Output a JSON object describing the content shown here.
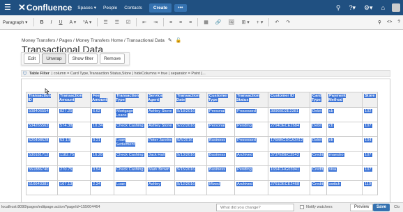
{
  "topnav": {
    "logo": "Confluence",
    "menu": [
      "Spaces ▾",
      "People",
      "Contacts"
    ],
    "create_label": "Create",
    "more_label": "•••",
    "icons": [
      "search-icon",
      "help-icon",
      "settings-icon",
      "notifications-icon",
      "avatar"
    ]
  },
  "toolbar": {
    "paragraph_label": "Paragraph ▾",
    "buttons": [
      "B",
      "I",
      "U",
      "A ▾",
      "¹A ▾",
      "☰",
      "☰",
      "☑",
      "⇤",
      "⇥",
      "≡",
      "≡",
      "≡",
      "▦",
      "🔗",
      "🖼",
      "⊞ ▾",
      "+ ▾",
      "↶",
      "↷"
    ]
  },
  "breadcrumb": "Money Transfers / Pages / Money Transfers Home / Transactional Data",
  "page_title": "Transactional Data",
  "actions": {
    "edit": "Edit",
    "unwrap": "Unwrap",
    "show_filter": "Show filter",
    "remove": "Remove"
  },
  "macro": {
    "name": "Table Filter",
    "params": "| column = Card Type,Transaction Status,Store | hideColumns = true | separator = Point (..."
  },
  "table": {
    "headers": [
      "Transaction ID",
      "Transaction Amount",
      "Fee Amount",
      "Transaction Type",
      "Service Agent",
      "Transaction Date",
      "Customer Type",
      "Transaction Status",
      "Customer ID",
      "Card Type",
      "Payment Method",
      "Store"
    ],
    "rows": [
      [
        "508406554",
        "827.25",
        "6.62",
        "Mortgage Loans",
        "Ashley Stone",
        "9/18/2016",
        "Personal",
        "Processed",
        "3896BD2E2381",
        "Debit",
        "cb",
        "102"
      ],
      [
        "534265563",
        "574.38",
        "10.34",
        "Check Cashing",
        "Ashley Stone",
        "9/22/2016",
        "Personal",
        "Pending",
        "2794DECE2684",
        "Debit",
        "cb",
        "107"
      ],
      [
        "520498528",
        "53.13",
        "0.21",
        "Loan Settlement",
        "Peter Jacobs",
        "9/5/2016",
        "Business",
        "Processed",
        "176BBGDGA3412",
        "Debit",
        "cb",
        "104"
      ],
      [
        "530181712",
        "1182.75",
        "16.28",
        "Check Cashing",
        "Jack Hall",
        "9/13/2016",
        "Business",
        "Archived",
        "3737EBEC3543",
        "Credit",
        "maestro",
        "107"
      ],
      [
        "551886740",
        "270.75",
        "0.54",
        "Check Cashing",
        "Mark Brown",
        "9/15/2016",
        "Business",
        "Pending",
        "1654CHG03941",
        "Credit",
        "visa",
        "107"
      ],
      [
        "516643381",
        "167.13",
        "2.34",
        "Loan",
        "Ashley",
        "9/12/2016",
        "Mixed",
        "Archived",
        "2761DECE2468",
        "Credit",
        "switch",
        "110"
      ]
    ]
  },
  "status": {
    "url": "localhost:8090/pages/editpage.action?pageId=155004464",
    "change_placeholder": "What did you change?",
    "notify_label": "Notify watchers",
    "preview_label": "Preview",
    "save_label": "Save",
    "close_label": "Clo"
  }
}
